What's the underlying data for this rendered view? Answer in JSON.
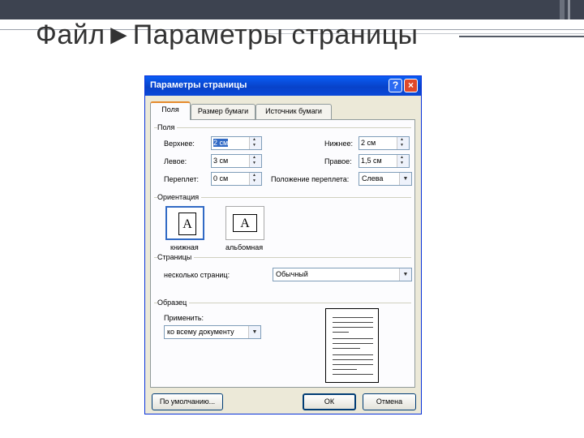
{
  "slide": {
    "title": "Файл►Параметры страницы"
  },
  "dialog": {
    "title": "Параметры страницы",
    "help_label": "?",
    "close_label": "×",
    "tabs": [
      {
        "label": "Поля",
        "active": true
      },
      {
        "label": "Размер бумаги",
        "active": false
      },
      {
        "label": "Источник бумаги",
        "active": false
      }
    ],
    "margins": {
      "group_label": "Поля",
      "top": {
        "label": "Верхнее:",
        "value": "2 см"
      },
      "bottom": {
        "label": "Нижнее:",
        "value": "2 см"
      },
      "left": {
        "label": "Левое:",
        "value": "3 см"
      },
      "right": {
        "label": "Правое:",
        "value": "1,5 см"
      },
      "gutter": {
        "label": "Переплет:",
        "value": "0 см"
      },
      "gutter_pos": {
        "label": "Положение переплета:",
        "value": "Слева"
      }
    },
    "orientation": {
      "group_label": "Ориентация",
      "portrait": {
        "glyph": "A",
        "label": "книжная",
        "selected": true
      },
      "landscape": {
        "glyph": "A",
        "label": "альбомная",
        "selected": false
      }
    },
    "pages": {
      "group_label": "Страницы",
      "multiple_label": "несколько страниц:",
      "multiple_value": "Обычный"
    },
    "sample": {
      "group_label": "Образец",
      "apply_label": "Применить:",
      "apply_value": "ко всему документу"
    },
    "buttons": {
      "default": "По умолчанию...",
      "ok": "ОК",
      "cancel": "Отмена"
    },
    "colors": {
      "titlebar": "#0a5ef5",
      "selection": "#316ac5",
      "active_tab_accent": "#e68b2c"
    }
  }
}
